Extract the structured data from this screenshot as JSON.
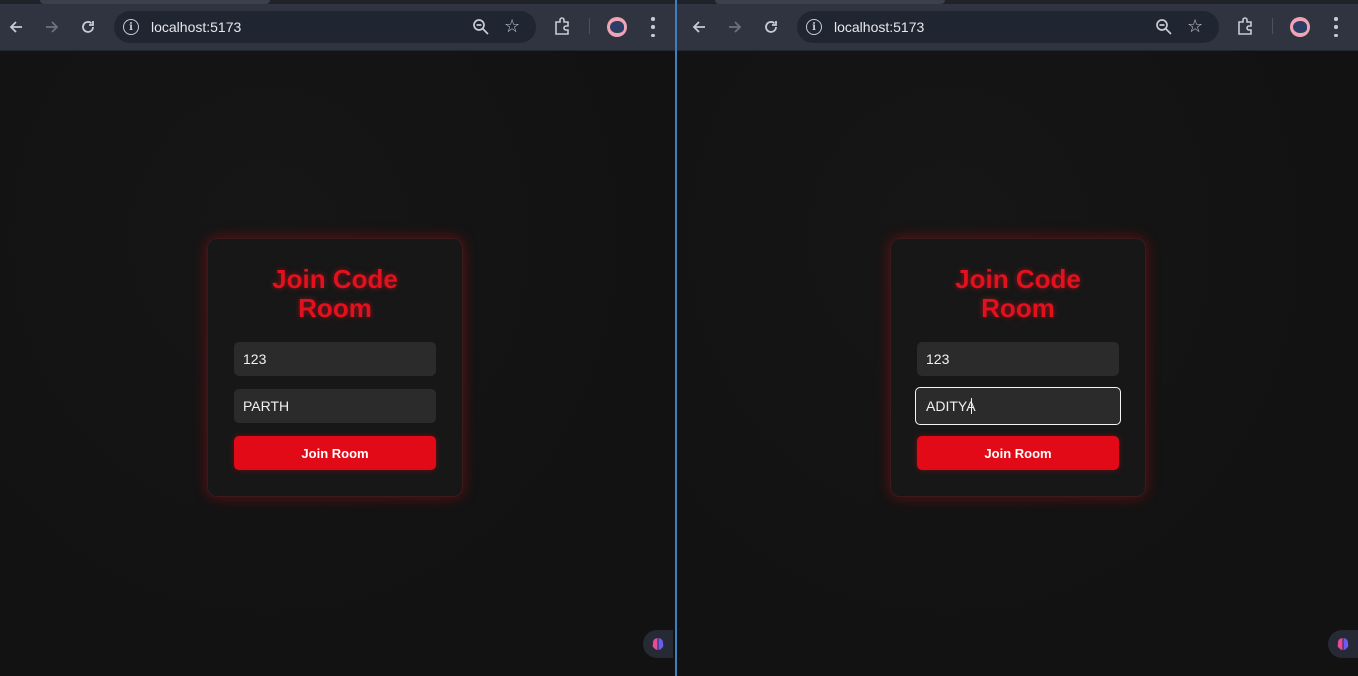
{
  "left_window": {
    "url": "localhost:5173",
    "card": {
      "title_line1": "Join Code",
      "title_line2": "Room",
      "room_id_value": "123",
      "username_value": "PARTH",
      "join_label": "Join Room"
    }
  },
  "right_window": {
    "url": "localhost:5173",
    "card": {
      "title_line1": "Join Code",
      "title_line2": "Room",
      "room_id_value": "123",
      "username_value": "ADITYA",
      "join_label": "Join Room"
    }
  },
  "colors": {
    "accent": "#e30a17",
    "page_background": "#131313",
    "card_background": "#171717",
    "toolbar": "#2f3440",
    "split_divider": "#3d7fc1"
  },
  "icons": [
    "back-arrow-icon",
    "forward-arrow-icon",
    "reload-icon",
    "site-info-icon",
    "zoom-icon",
    "bookmark-star-icon",
    "extensions-puzzle-icon",
    "profile-avatar-icon",
    "more-menu-icon",
    "brain-extension-icon"
  ]
}
